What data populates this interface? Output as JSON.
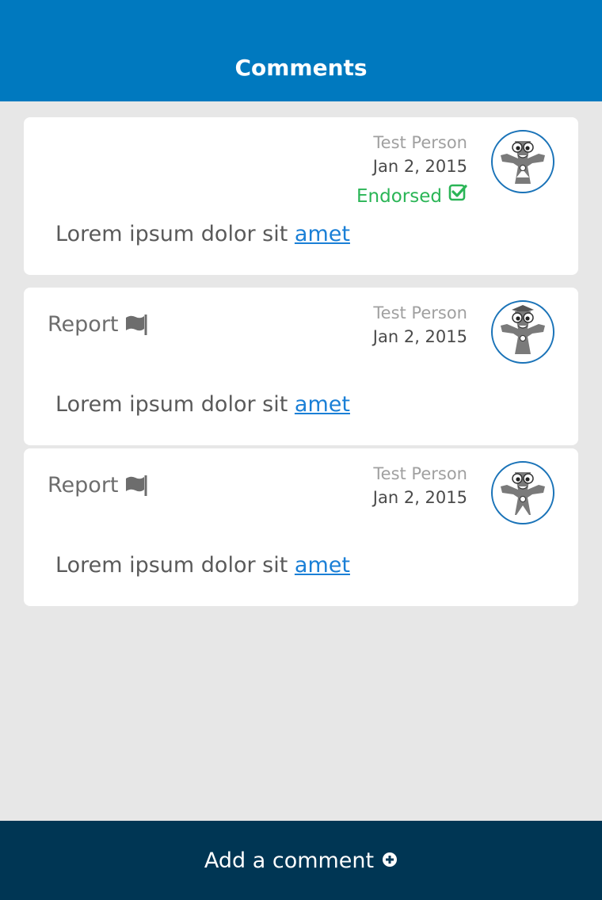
{
  "header": {
    "title": "Comments"
  },
  "comments": [
    {
      "author": "Test Person",
      "date": "Jan 2, 2015",
      "endorsed_label": "Endorsed",
      "body": "Lorem ipsum dolor sit ",
      "link": "amet"
    },
    {
      "report_label": "Report",
      "author": "Test Person",
      "date": "Jan 2, 2015",
      "body": "Lorem ipsum dolor sit ",
      "link": "amet"
    },
    {
      "report_label": "Report",
      "author": "Test Person",
      "date": "Jan 2, 2015",
      "body": "Lorem ipsum dolor sit ",
      "link": "amet"
    }
  ],
  "footer": {
    "add_comment_label": "Add a comment"
  },
  "colors": {
    "header_bg": "#0079bf",
    "footer_bg": "#003654",
    "endorsed": "#2ab556",
    "link": "#1a7fd6"
  },
  "icons": [
    "check-square-icon",
    "flag-icon",
    "plus-circle-icon",
    "avatar-mascot"
  ]
}
